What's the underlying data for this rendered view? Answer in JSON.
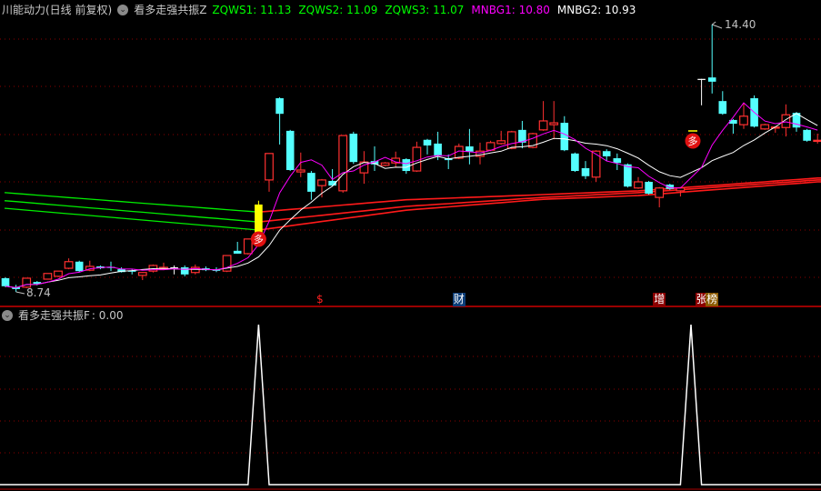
{
  "header": {
    "title": "川能动力(日线 前复权)",
    "indicator": "看多走强共振Z",
    "items": [
      {
        "label": "ZQWS1: 11.13",
        "color": "#00ff00"
      },
      {
        "label": "ZQWS2: 11.09",
        "color": "#00ff00"
      },
      {
        "label": "ZQWS3: 11.07",
        "color": "#00ff00"
      },
      {
        "label": "MNBG1: 10.80",
        "color": "#ff00ff"
      },
      {
        "label": "MNBG2: 10.93",
        "color": "#ffffff"
      }
    ]
  },
  "sub_header": {
    "indicator": "看多走强共振F",
    "value": ": 0.00"
  },
  "icons": {
    "collapse": "chevron-down-circle-icon",
    "signal": "duo-signal-icon"
  },
  "annotations": {
    "high_label": "14.40",
    "low_label": "8.74",
    "signal_char": "多"
  },
  "events": [
    {
      "label": "$",
      "color": "#ff2020",
      "bg": "transparent",
      "slot": 30
    },
    {
      "label": "财",
      "color": "#ffffff",
      "bg": "#0b3d78",
      "slot": 43
    },
    {
      "label": "增",
      "color": "#ffffff",
      "bg": "#8b0000",
      "slot": 62
    },
    {
      "label": "张",
      "color": "#ffffff",
      "bg": "#8b0000",
      "slot": 66
    },
    {
      "label": "榜",
      "color": "#ffffff",
      "bg": "#8b5a00",
      "slot": 67
    }
  ],
  "colors": {
    "up": "#ff3030",
    "down": "#54ffff",
    "flat": "#ffffff",
    "limit": "#ffff00",
    "ma_fast": "#ff00ff",
    "ma_slow": "#ffffff",
    "band_old": "#00ee00",
    "band_new": "#ff1a1a",
    "grid": "#8b0000",
    "bg": "#000000"
  },
  "chart_data": [
    {
      "type": "candlestick",
      "title": "川能动力 日线",
      "ylim": [
        8.74,
        14.4
      ],
      "ohlc_fields": [
        "open",
        "close",
        "high",
        "low"
      ],
      "limit_up_index": 24,
      "signal_indices": [
        24,
        65
      ],
      "candles": [
        [
          9.03,
          8.86,
          9.05,
          8.84
        ],
        [
          8.84,
          8.8,
          8.89,
          8.74
        ],
        [
          8.84,
          9.03,
          9.03,
          8.82
        ],
        [
          8.95,
          8.91,
          8.97,
          8.88
        ],
        [
          9.01,
          9.13,
          9.13,
          9.0
        ],
        [
          9.07,
          9.18,
          9.18,
          9.05
        ],
        [
          9.24,
          9.38,
          9.45,
          9.22
        ],
        [
          9.38,
          9.18,
          9.4,
          9.16
        ],
        [
          9.2,
          9.28,
          9.4,
          9.18
        ],
        [
          9.28,
          9.24,
          9.3,
          9.22
        ],
        [
          9.27,
          9.26,
          9.38,
          9.18
        ],
        [
          9.22,
          9.16,
          9.26,
          9.15
        ],
        [
          9.19,
          9.18,
          9.22,
          9.11
        ],
        [
          9.09,
          9.15,
          9.16,
          8.99
        ],
        [
          9.18,
          9.3,
          9.32,
          9.15
        ],
        [
          9.22,
          9.26,
          9.36,
          9.2
        ],
        [
          9.26,
          9.26,
          9.3,
          9.11
        ],
        [
          9.26,
          9.11,
          9.3,
          9.07
        ],
        [
          9.15,
          9.26,
          9.32,
          9.11
        ],
        [
          9.24,
          9.2,
          9.28,
          9.18
        ],
        [
          9.21,
          9.2,
          9.26,
          9.16
        ],
        [
          9.18,
          9.51,
          9.51,
          9.16
        ],
        [
          9.61,
          9.55,
          9.8,
          9.55
        ],
        [
          9.55,
          9.86,
          9.86,
          9.53
        ],
        [
          9.97,
          10.59,
          10.67,
          9.97
        ],
        [
          11.11,
          11.67,
          11.67,
          10.86
        ],
        [
          12.84,
          12.51,
          12.86,
          11.86
        ],
        [
          12.15,
          11.32,
          12.17,
          11.3
        ],
        [
          11.28,
          11.32,
          11.69,
          11.17
        ],
        [
          11.26,
          10.86,
          11.3,
          10.69
        ],
        [
          10.99,
          11.11,
          11.13,
          10.74
        ],
        [
          11.09,
          10.99,
          11.34,
          10.97
        ],
        [
          10.88,
          12.05,
          12.05,
          10.84
        ],
        [
          12.09,
          11.49,
          12.13,
          11.45
        ],
        [
          11.26,
          11.49,
          11.72,
          11.03
        ],
        [
          11.51,
          11.44,
          11.82,
          11.3
        ],
        [
          11.42,
          11.47,
          11.49,
          11.4
        ],
        [
          11.47,
          11.57,
          11.71,
          11.38
        ],
        [
          11.55,
          11.3,
          11.57,
          11.24
        ],
        [
          11.3,
          11.8,
          11.92,
          11.28
        ],
        [
          11.96,
          11.84,
          11.98,
          11.65
        ],
        [
          11.88,
          11.63,
          12.13,
          11.53
        ],
        [
          11.57,
          11.53,
          11.65,
          11.34
        ],
        [
          11.57,
          11.82,
          11.88,
          11.55
        ],
        [
          11.82,
          11.71,
          12.19,
          11.44
        ],
        [
          11.61,
          11.72,
          11.9,
          11.44
        ],
        [
          11.74,
          11.9,
          11.94,
          11.72
        ],
        [
          11.88,
          11.94,
          12.15,
          11.86
        ],
        [
          11.78,
          12.13,
          12.15,
          11.76
        ],
        [
          12.17,
          11.9,
          12.36,
          11.78
        ],
        [
          11.8,
          12.09,
          12.11,
          11.78
        ],
        [
          12.17,
          12.36,
          12.78,
          12.15
        ],
        [
          12.28,
          12.32,
          12.78,
          11.97
        ],
        [
          12.32,
          11.74,
          12.46,
          11.72
        ],
        [
          11.67,
          11.3,
          11.69,
          11.28
        ],
        [
          11.36,
          11.19,
          11.51,
          11.13
        ],
        [
          11.17,
          11.72,
          11.74,
          11.07
        ],
        [
          11.72,
          11.61,
          11.76,
          11.51
        ],
        [
          11.57,
          11.47,
          11.67,
          11.32
        ],
        [
          11.44,
          10.97,
          11.46,
          10.95
        ],
        [
          10.94,
          11.07,
          11.17,
          10.92
        ],
        [
          11.07,
          10.82,
          11.09,
          10.8
        ],
        [
          10.74,
          10.94,
          10.96,
          10.53
        ],
        [
          11.01,
          10.92,
          11.03,
          10.9
        ],
        [
          10.88,
          10.94,
          10.96,
          10.76
        ],
        null,
        [
          13.25,
          13.25,
          13.25,
          12.69
        ],
        [
          13.28,
          13.19,
          14.4,
          12.94
        ],
        [
          12.78,
          12.51,
          12.99,
          12.49
        ],
        [
          12.38,
          12.3,
          12.4,
          12.09
        ],
        [
          12.28,
          12.46,
          12.74,
          12.19
        ],
        [
          12.84,
          12.24,
          12.9,
          12.22
        ],
        [
          12.19,
          12.28,
          12.3,
          12.17
        ],
        [
          12.22,
          12.23,
          12.24,
          12.11
        ],
        [
          12.22,
          12.49,
          12.71,
          12.03
        ],
        [
          12.53,
          12.22,
          12.55,
          12.13
        ],
        [
          12.17,
          11.94,
          12.19,
          11.92
        ],
        [
          11.94,
          11.95,
          12.09,
          11.88
        ]
      ],
      "ma_periods": {
        "fast": 5,
        "slow": 10
      },
      "bands": {
        "switch_index": 24,
        "knot_indices": [
          0,
          24,
          38,
          51,
          60,
          77
        ],
        "series": [
          {
            "name": "ZQWS1",
            "values": [
              10.84,
              10.43,
              10.69,
              10.8,
              10.88,
              11.15
            ]
          },
          {
            "name": "ZQWS2",
            "values": [
              10.67,
              10.22,
              10.55,
              10.74,
              10.84,
              11.11
            ]
          },
          {
            "name": "ZQWS3",
            "values": [
              10.51,
              10.05,
              10.47,
              10.7,
              10.78,
              11.07
            ]
          }
        ]
      }
    },
    {
      "type": "line",
      "title": "看多走强共振F",
      "ylim": [
        0,
        1
      ],
      "signal_values_at": [
        24,
        65
      ],
      "series": [
        {
          "name": "看多走强共振F",
          "nonzero": {
            "24": 1,
            "65": 1
          },
          "default": 0
        }
      ]
    }
  ]
}
